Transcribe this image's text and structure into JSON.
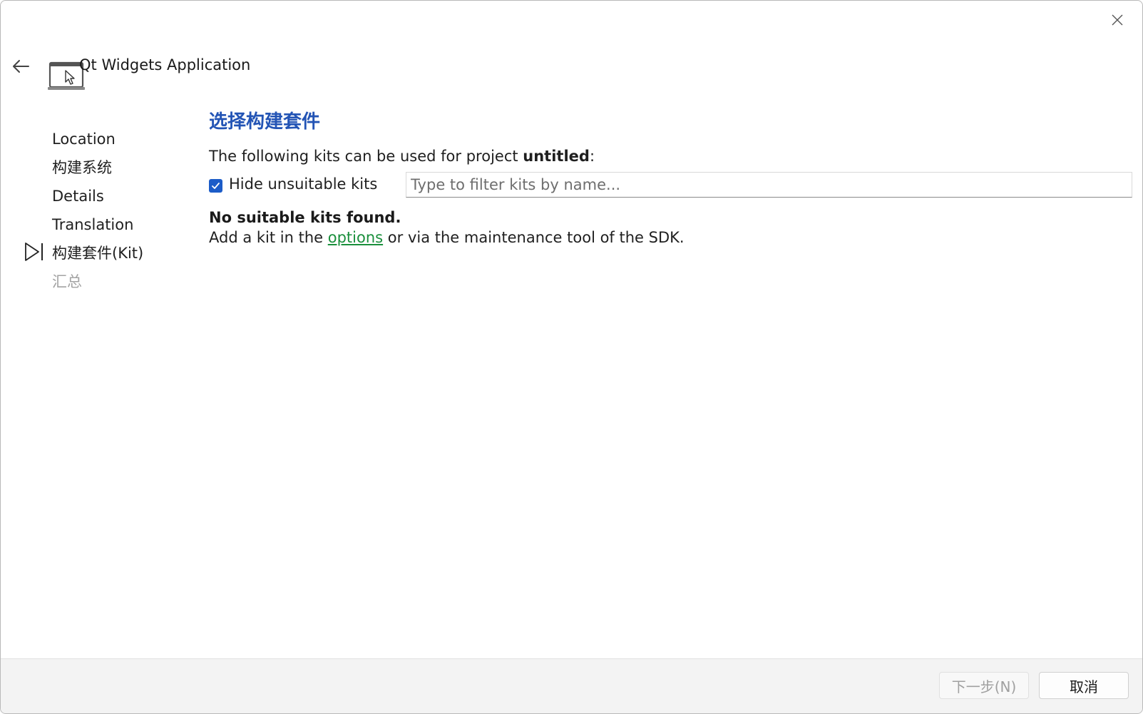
{
  "wizard": {
    "title": "Qt Widgets Application"
  },
  "steps": [
    {
      "label": "Location",
      "state": "done"
    },
    {
      "label": "构建系统",
      "state": "done"
    },
    {
      "label": "Details",
      "state": "done"
    },
    {
      "label": "Translation",
      "state": "done"
    },
    {
      "label": "构建套件(Kit)",
      "state": "current"
    },
    {
      "label": "汇总",
      "state": "disabled"
    }
  ],
  "page": {
    "heading": "选择构建套件",
    "intro_prefix": "The following kits can be used for project ",
    "project_name": "untitled",
    "intro_suffix": ":",
    "hide_unsuitable": {
      "label": "Hide unsuitable kits",
      "checked": true
    },
    "filter": {
      "placeholder": "Type to filter kits by name...",
      "value": ""
    },
    "no_kits_message": "No suitable kits found.",
    "hint_prefix": "Add a kit in the ",
    "hint_link": "options",
    "hint_suffix": " or via the maintenance tool of the SDK."
  },
  "footer": {
    "next_label": "下一步(N)",
    "cancel_label": "取消"
  },
  "icons": {
    "close": "close-icon",
    "back": "back-arrow-icon",
    "app": "desktop-application-icon",
    "step_indicator": "play-step-icon",
    "checkbox": "checkmark-icon"
  },
  "colors": {
    "heading": "#2354b5",
    "link": "#1a8f3c",
    "checkbox": "#1c5cc8",
    "disabled_text": "#a3a3a3"
  }
}
